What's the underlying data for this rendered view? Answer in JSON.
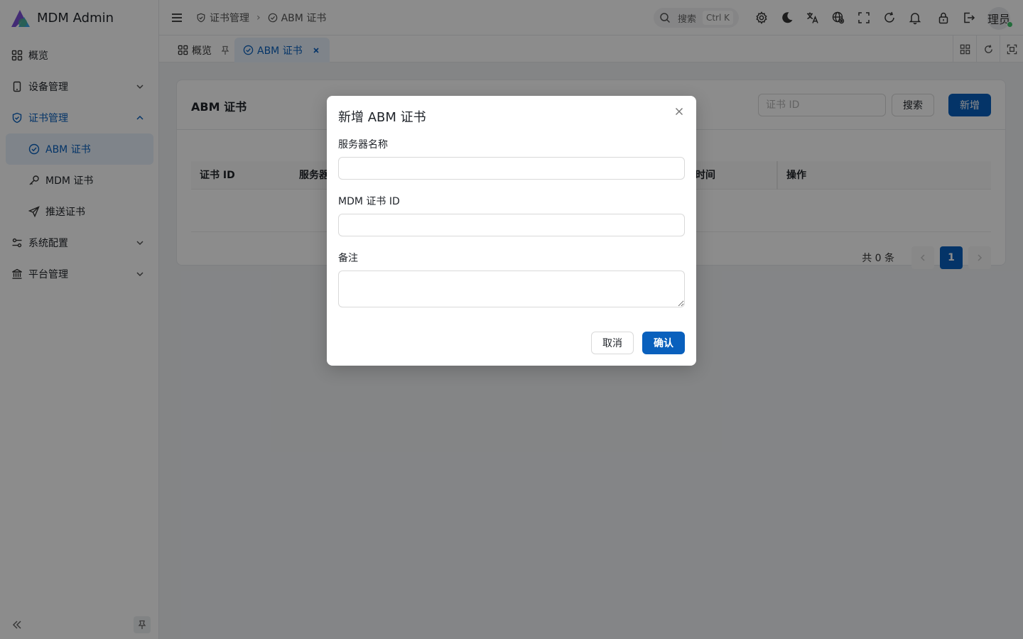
{
  "app": {
    "title": "MDM Admin"
  },
  "sidebar": {
    "items": [
      {
        "label": "概览",
        "icon": "dashboard-icon"
      },
      {
        "label": "设备管理",
        "icon": "device-icon"
      },
      {
        "label": "证书管理",
        "icon": "shield-check-icon"
      },
      {
        "label": "系统配置",
        "icon": "settings-sliders-icon"
      },
      {
        "label": "平台管理",
        "icon": "bank-icon"
      }
    ],
    "cert_submenu": [
      {
        "label": "ABM 证书",
        "icon": "check-circle-icon"
      },
      {
        "label": "MDM 证书",
        "icon": "key-icon"
      },
      {
        "label": "推送证书",
        "icon": "send-icon"
      }
    ]
  },
  "header": {
    "breadcrumb": [
      "证书管理",
      "ABM 证书"
    ],
    "search_label": "搜索",
    "search_shortcut": "Ctrl K",
    "user_name": "理员"
  },
  "tabs": [
    {
      "label": "概览"
    },
    {
      "label": "ABM 证书"
    }
  ],
  "page": {
    "title": "ABM 证书",
    "search_placeholder": "证书 ID",
    "search_button": "搜索",
    "add_button": "新增",
    "table": {
      "columns": [
        "证书 ID",
        "服务器",
        "时间",
        "操作"
      ]
    },
    "pagination": {
      "total_text": "共 0 条",
      "current_page": "1"
    }
  },
  "modal": {
    "title": "新增 ABM 证书",
    "fields": {
      "server_name_label": "服务器名称",
      "mdm_cert_id_label": "MDM 证书 ID",
      "remark_label": "备注"
    },
    "cancel_label": "取消",
    "confirm_label": "确认"
  },
  "colors": {
    "primary": "#0960bd",
    "mask": "rgba(0,0,0,0.45)",
    "online": "#3ec56a"
  }
}
